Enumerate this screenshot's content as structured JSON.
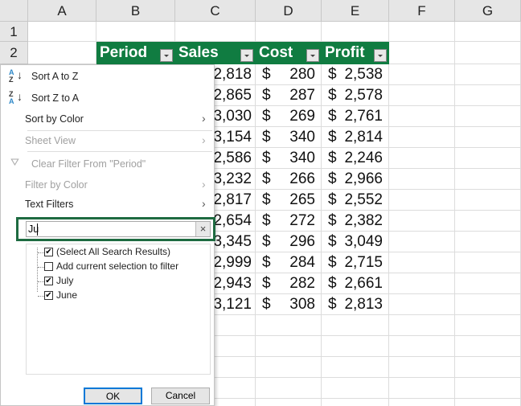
{
  "columns": [
    "A",
    "B",
    "C",
    "D",
    "E",
    "F",
    "G"
  ],
  "rows": [
    "1",
    "2"
  ],
  "table": {
    "headers": [
      "Period",
      "Sales",
      "Cost",
      "Profit"
    ],
    "sales": [
      "2,818",
      "2,865",
      "3,030",
      "3,154",
      "2,586",
      "3,232",
      "2,817",
      "2,654",
      "3,345",
      "2,999",
      "2,943",
      "3,121"
    ],
    "cost": [
      "280",
      "287",
      "269",
      "340",
      "340",
      "266",
      "265",
      "272",
      "296",
      "284",
      "282",
      "308"
    ],
    "profit": [
      "2,538",
      "2,578",
      "2,761",
      "2,814",
      "2,246",
      "2,966",
      "2,552",
      "2,382",
      "3,049",
      "2,715",
      "2,661",
      "2,813"
    ],
    "currency": "$",
    "header_color": "#107c41"
  },
  "menu": {
    "sort_az": "Sort A to Z",
    "sort_za": "Sort Z to A",
    "sort_color": "Sort by Color",
    "sheet_view": "Sheet View",
    "clear_filter": "Clear Filter From \"Period\"",
    "filter_color": "Filter by Color",
    "text_filters": "Text Filters",
    "search_value": "Ju",
    "items": [
      {
        "label": "(Select All Search Results)",
        "checked": true
      },
      {
        "label": "Add current selection to filter",
        "checked": false
      },
      {
        "label": "July",
        "checked": true
      },
      {
        "label": "June",
        "checked": true
      }
    ],
    "ok": "OK",
    "cancel": "Cancel"
  }
}
